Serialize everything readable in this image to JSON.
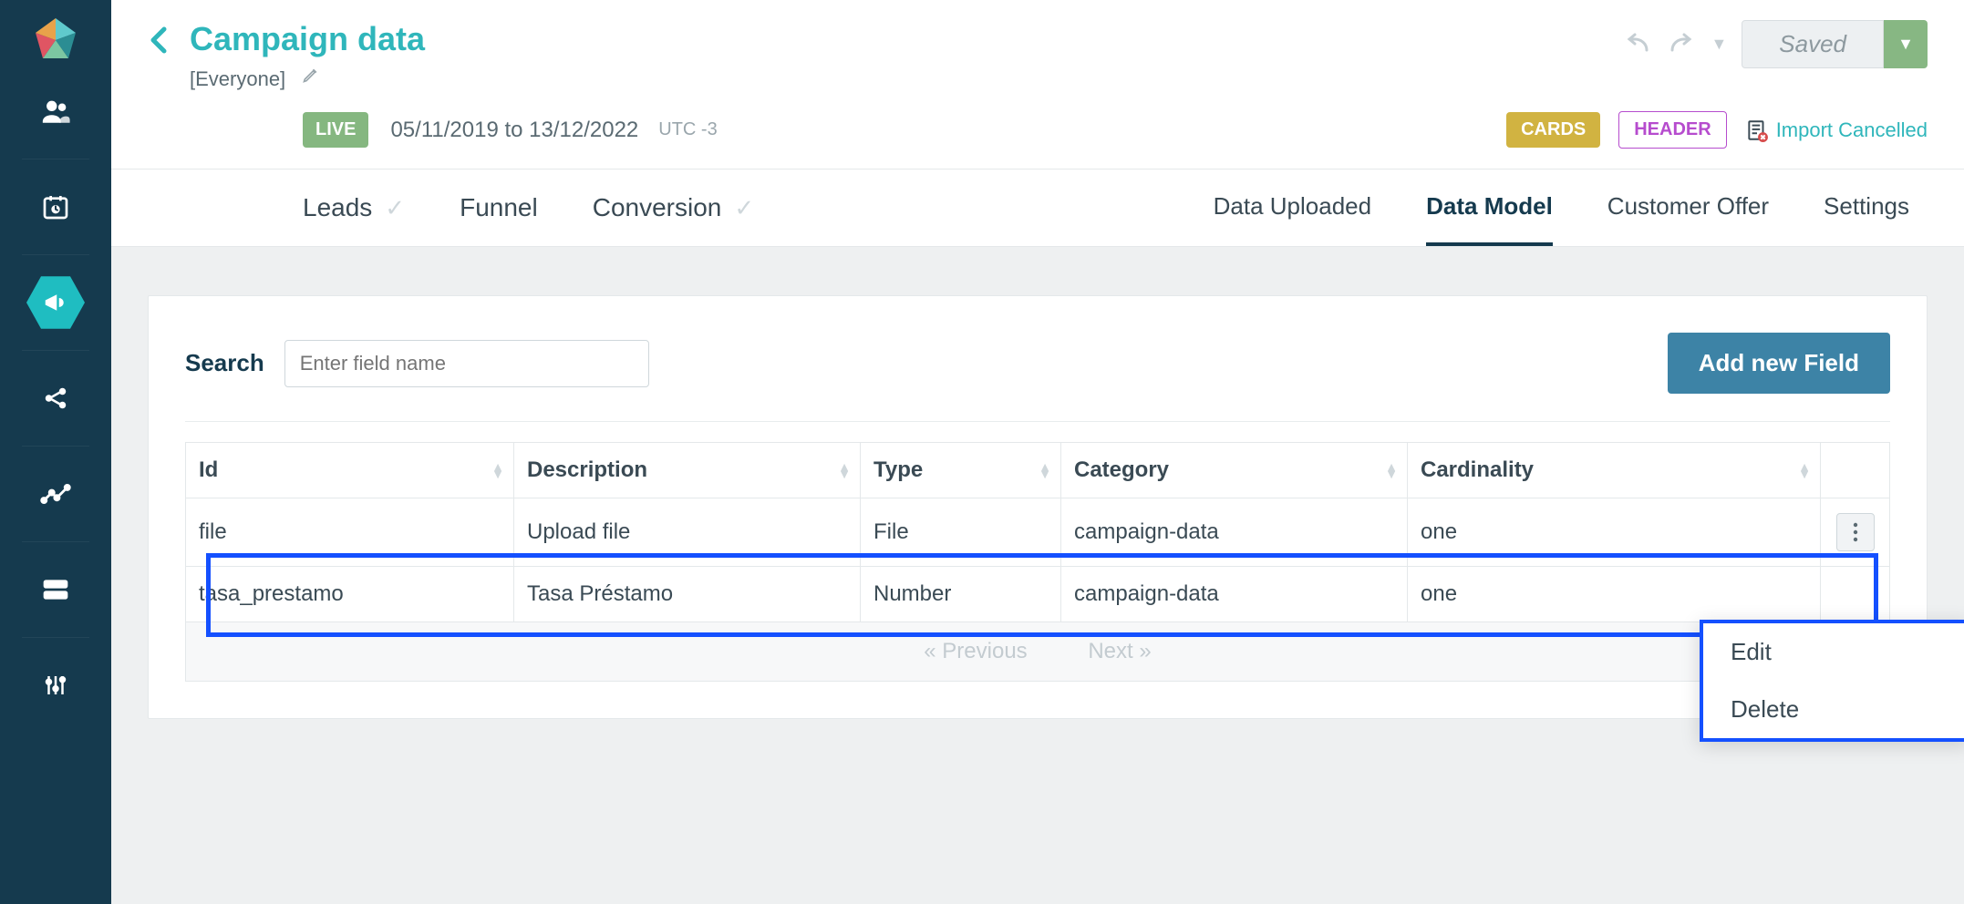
{
  "sidebar": {
    "items": [
      {
        "name": "users"
      },
      {
        "name": "calendar"
      },
      {
        "name": "megaphone",
        "active": true
      },
      {
        "name": "share"
      },
      {
        "name": "analytics"
      },
      {
        "name": "servers"
      },
      {
        "name": "sliders"
      }
    ]
  },
  "header": {
    "title": "Campaign data",
    "scope": "[Everyone]",
    "live_badge": "LIVE",
    "date_range": "05/11/2019 to 13/12/2022",
    "timezone": "UTC -3",
    "saved_label": "Saved",
    "cards_chip": "CARDS",
    "header_chip": "HEADER",
    "import_status": "Import Cancelled"
  },
  "breadcrumbs": [
    {
      "label": "Leads",
      "check": true
    },
    {
      "label": "Funnel",
      "check": false
    },
    {
      "label": "Conversion",
      "check": true
    }
  ],
  "tabs": [
    {
      "label": "Data Uploaded",
      "active": false
    },
    {
      "label": "Data Model",
      "active": true
    },
    {
      "label": "Customer Offer",
      "active": false
    },
    {
      "label": "Settings",
      "active": false
    }
  ],
  "panel": {
    "search_label": "Search",
    "search_placeholder": "Enter field name",
    "add_button": "Add new Field",
    "columns": [
      "Id",
      "Description",
      "Type",
      "Category",
      "Cardinality"
    ],
    "rows": [
      {
        "id": "file",
        "description": "Upload file",
        "type": "File",
        "category": "campaign-data",
        "cardinality": "one",
        "highlighted": true
      },
      {
        "id": "tasa_prestamo",
        "description": "Tasa Préstamo",
        "type": "Number",
        "category": "campaign-data",
        "cardinality": "one"
      }
    ],
    "pager": {
      "prev": "« Previous",
      "next": "Next »"
    }
  },
  "popup": {
    "items": [
      {
        "label": "Edit"
      },
      {
        "label": "Delete"
      }
    ]
  }
}
